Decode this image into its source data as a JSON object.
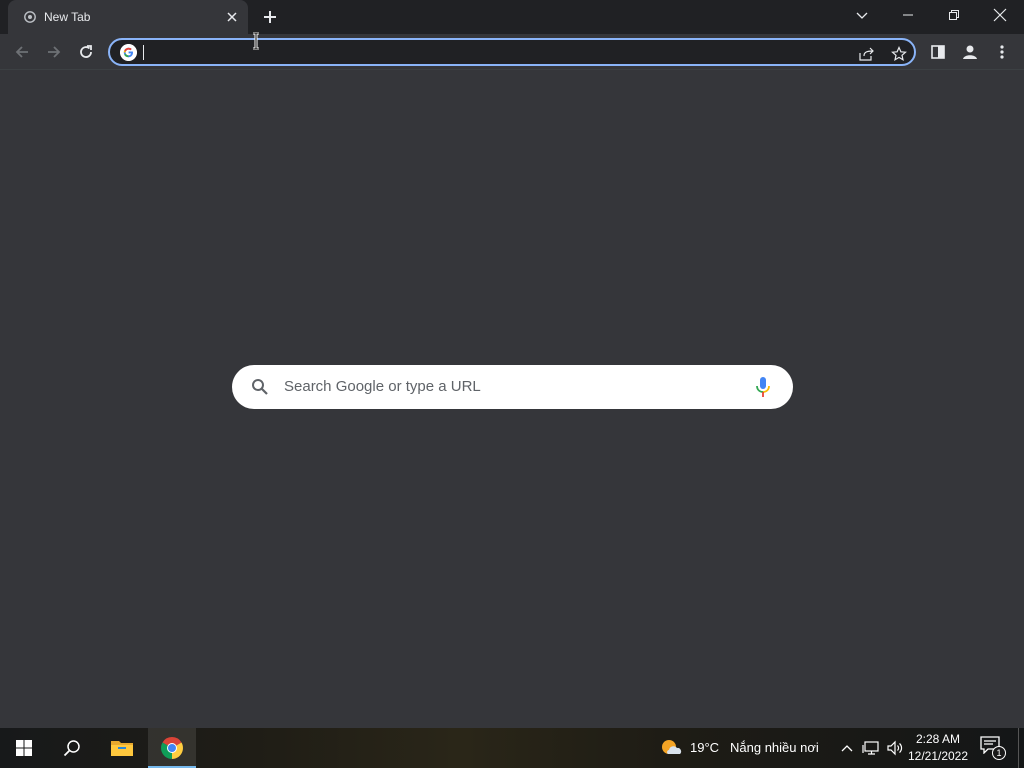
{
  "browser": {
    "tab": {
      "title": "New Tab",
      "favicon": "chrome-icon"
    },
    "omnibox": {
      "value": "",
      "placeholder": ""
    },
    "toolbar_icons": [
      "back-icon",
      "forward-icon",
      "reload-icon",
      "share-icon",
      "star-icon",
      "side-panel-icon",
      "profile-icon",
      "menu-icon"
    ]
  },
  "ntp": {
    "search_placeholder": "Search Google or type a URL"
  },
  "taskbar": {
    "apps": [
      "start-icon",
      "search-icon",
      "file-explorer-icon",
      "chrome-icon"
    ],
    "weather": {
      "temp": "19°C",
      "desc": "Nắng nhiều nơi"
    },
    "clock": {
      "time": "2:28 AM",
      "date": "12/21/2022"
    },
    "notifications": "1"
  },
  "colors": {
    "titlebar": "#202124",
    "toolbar": "#35363a",
    "omnibox_border": "#8ab4f8",
    "accent": "#76b9ed"
  }
}
